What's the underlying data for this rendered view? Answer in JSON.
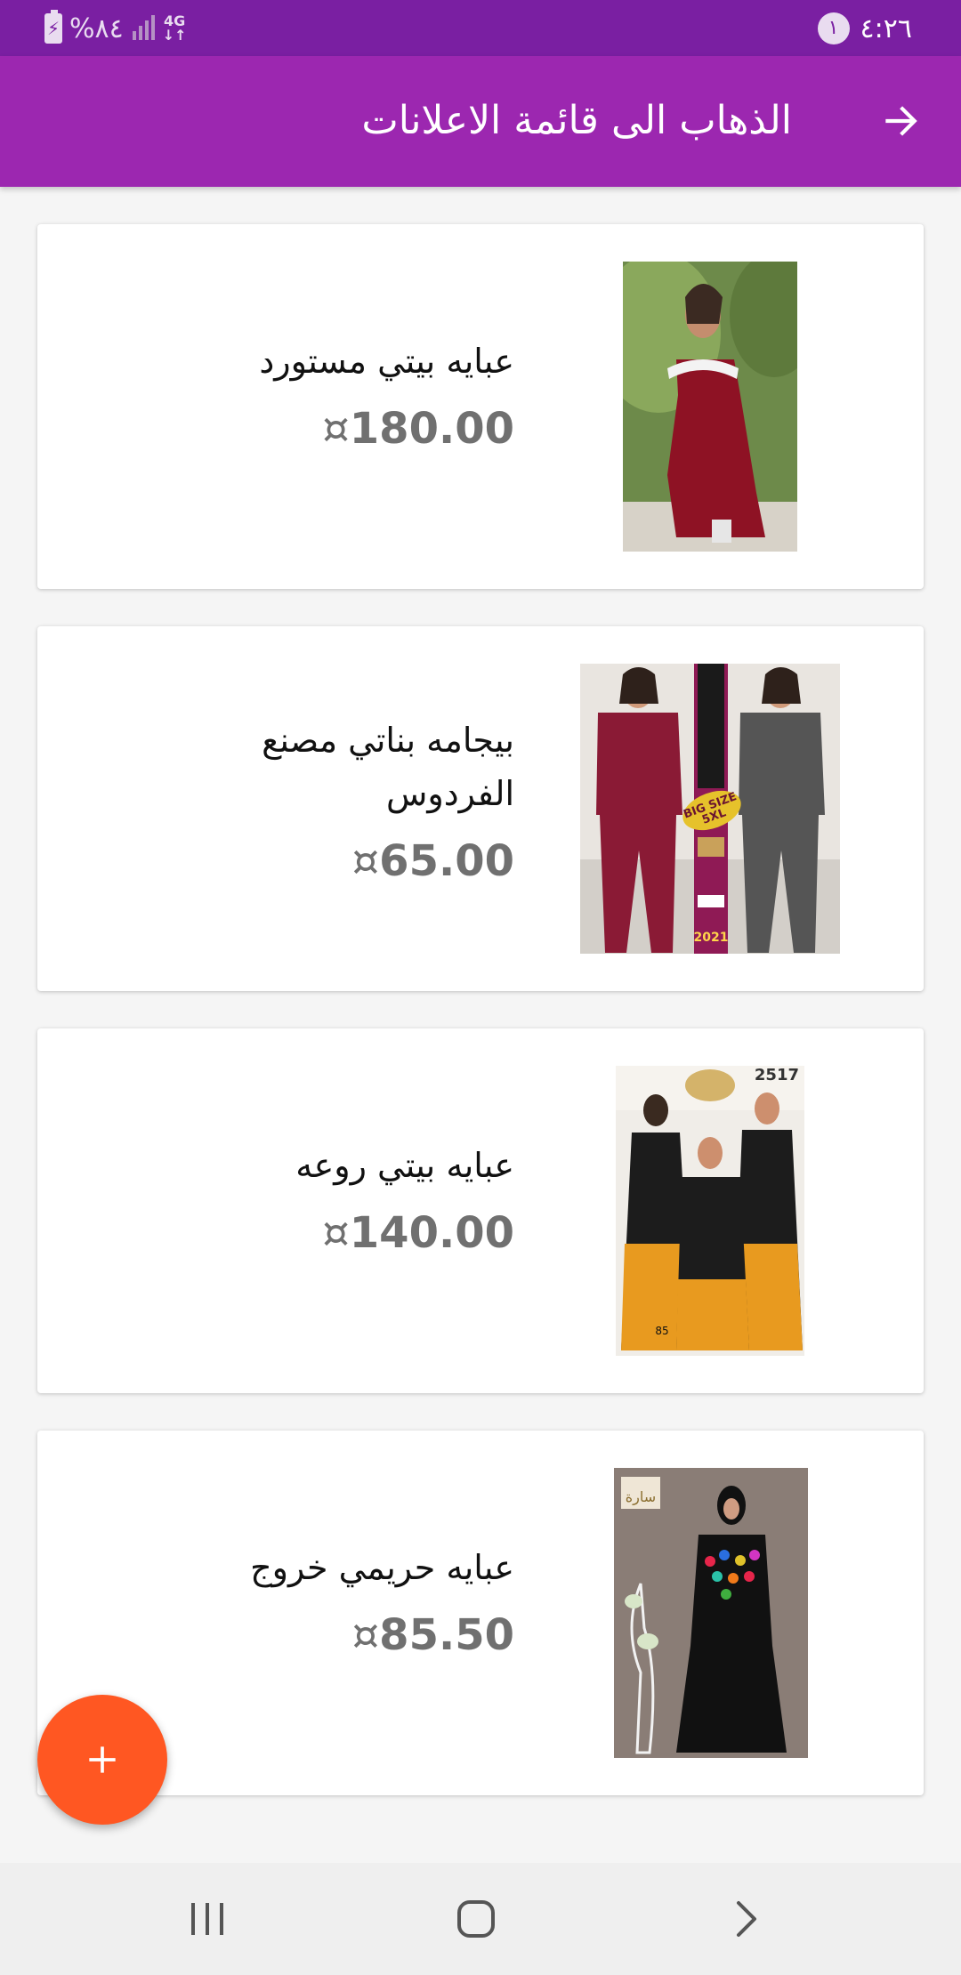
{
  "status_bar": {
    "time": "٤:٢٦",
    "notification_count": "١",
    "battery": "%٨٤",
    "network": "4G"
  },
  "app_bar": {
    "title": "الذهاب الى قائمة الاعلانات",
    "back_icon": "arrow-right-icon"
  },
  "listings": [
    {
      "title": "عبايه بيتي مستورد",
      "price": "180.00",
      "currency_symbol": "¤"
    },
    {
      "title": "بيجامه بناتي مصنع الفردوس",
      "price": "65.00",
      "currency_symbol": "¤"
    },
    {
      "title": "عبايه بيتي روعه",
      "price": "140.00",
      "currency_symbol": "¤"
    },
    {
      "title": "عبايه حريمي خروج",
      "price": "85.50",
      "currency_symbol": "¤"
    }
  ],
  "product_images": [
    {
      "overlay_text": []
    },
    {
      "overlay_text": [
        "BIG SIZE",
        "5XL",
        "2021"
      ]
    },
    {
      "overlay_text": [
        "2517",
        "85"
      ]
    },
    {
      "overlay_text": [
        "سارة"
      ]
    }
  ],
  "fab": {
    "icon": "plus-icon"
  },
  "nav_bar": {
    "recent_icon": "recent-apps-icon",
    "home_icon": "home-icon",
    "back_icon": "chevron-right-icon"
  },
  "colors": {
    "status_bar": "#7a1fa2",
    "app_bar": "#9c27b0",
    "fab": "#ff5722",
    "price_text": "#707070"
  }
}
